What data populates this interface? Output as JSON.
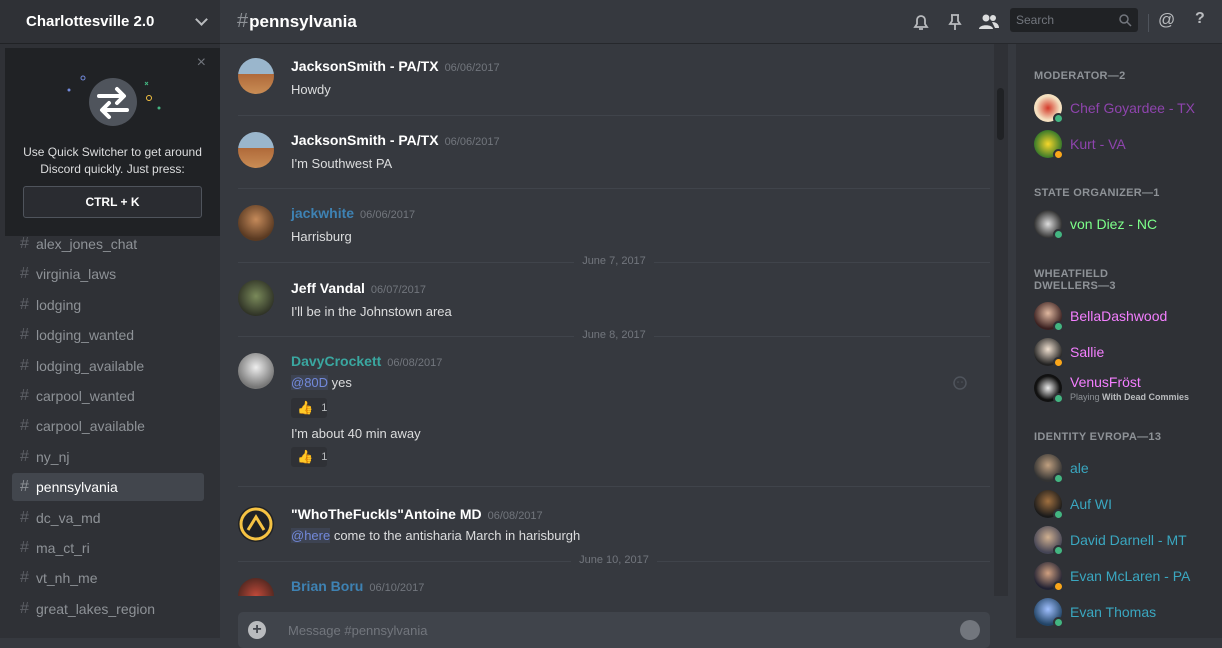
{
  "server": {
    "name": "Charlottesville 2.0"
  },
  "quick_switcher": {
    "text_line1": "Use Quick Switcher to get around",
    "text_line2": "Discord quickly. Just press:",
    "shortcut": "CTRL + K",
    "close": "×"
  },
  "channels": [
    {
      "name": "alex_jones_chat"
    },
    {
      "name": "virginia_laws"
    },
    {
      "name": "lodging"
    },
    {
      "name": "lodging_wanted"
    },
    {
      "name": "lodging_available"
    },
    {
      "name": "carpool_wanted"
    },
    {
      "name": "carpool_available"
    },
    {
      "name": "ny_nj"
    },
    {
      "name": "pennsylvania"
    },
    {
      "name": "dc_va_md"
    },
    {
      "name": "ma_ct_ri"
    },
    {
      "name": "vt_nh_me"
    },
    {
      "name": "great_lakes_region"
    }
  ],
  "channel_hash": "#",
  "header": {
    "channel_name": "pennsylvania",
    "search_placeholder": "Search",
    "icons": [
      "bell-icon",
      "pin-icon",
      "members-icon",
      "search-icon",
      "mention-icon",
      "help-icon"
    ],
    "mention_glyph": "@",
    "help_glyph": "?"
  },
  "messages": [
    {
      "author": "JacksonSmith - PA/TX",
      "timestamp": "06/06/2017",
      "text": "Howdy",
      "author_color": "#ffffff"
    },
    {
      "author": "JacksonSmith - PA/TX",
      "timestamp": "06/06/2017",
      "text": "I'm Southwest PA",
      "author_color": "#ffffff"
    },
    {
      "author": "jackwhite",
      "timestamp": "06/06/2017",
      "text": "Harrisburg",
      "author_color": "#3e82b3"
    },
    {
      "date_divider": "June 7, 2017"
    },
    {
      "author": "Jeff Vandal",
      "timestamp": "06/07/2017",
      "text": "I'll be in the Johnstown area",
      "author_color": "#ffffff"
    },
    {
      "date_divider": "June 8, 2017"
    },
    {
      "author": "DavyCrockett",
      "timestamp": "06/08/2017",
      "mention": "@80D",
      "text": " yes",
      "reaction1_count": "1",
      "text2": "I'm about 40 min away",
      "reaction2_count": "1",
      "author_color": "#3aa7a0"
    },
    {
      "author": "\"WhoTheFuckIs\"Antoine MD",
      "timestamp": "06/08/2017",
      "mention": "@here",
      "text": " come to the antisharia March in harisburgh",
      "author_color": "#ffffff"
    },
    {
      "date_divider": "June 10, 2017"
    },
    {
      "author": "Brian Boru",
      "timestamp": "06/10/2017",
      "author_color": "#3e82b3"
    }
  ],
  "composer": {
    "placeholder": "Message #pennsylvania",
    "plus": "+"
  },
  "members": {
    "roles": [
      {
        "title": "MODERATOR—2"
      },
      {
        "title": "STATE ORGANIZER—1"
      },
      {
        "title": "WHEATFIELD DWELLERS—3"
      },
      {
        "title": "IDENTITY EVROPA—13"
      }
    ],
    "list": [
      {
        "name": "Chef Goyardee - TX",
        "color": "#8e44ad",
        "status": "#43b581"
      },
      {
        "name": "Kurt - VA",
        "color": "#8e44ad",
        "status": "#faa61a"
      },
      {
        "name": "von Diez - NC",
        "color": "#7dff8a",
        "status": "#43b581"
      },
      {
        "name": "BellaDashwood",
        "color": "#f47fff",
        "status": "#43b581"
      },
      {
        "name": "Sallie",
        "color": "#f47fff",
        "status": "#faa61a"
      },
      {
        "name": "VenusFröst",
        "color": "#f47fff",
        "status": "#43b581",
        "activity_prefix": "Playing ",
        "activity_game": "With Dead Commies"
      },
      {
        "name": "ale",
        "color": "#3aa7c0",
        "status": "#43b581"
      },
      {
        "name": "Auf WI",
        "color": "#3aa7c0",
        "status": "#43b581"
      },
      {
        "name": "David Darnell - MT",
        "color": "#3aa7c0",
        "status": "#43b581"
      },
      {
        "name": "Evan McLaren - PA",
        "color": "#3aa7c0",
        "status": "#faa61a"
      },
      {
        "name": "Evan Thomas",
        "color": "#3aa7c0",
        "status": "#43b581"
      }
    ]
  }
}
